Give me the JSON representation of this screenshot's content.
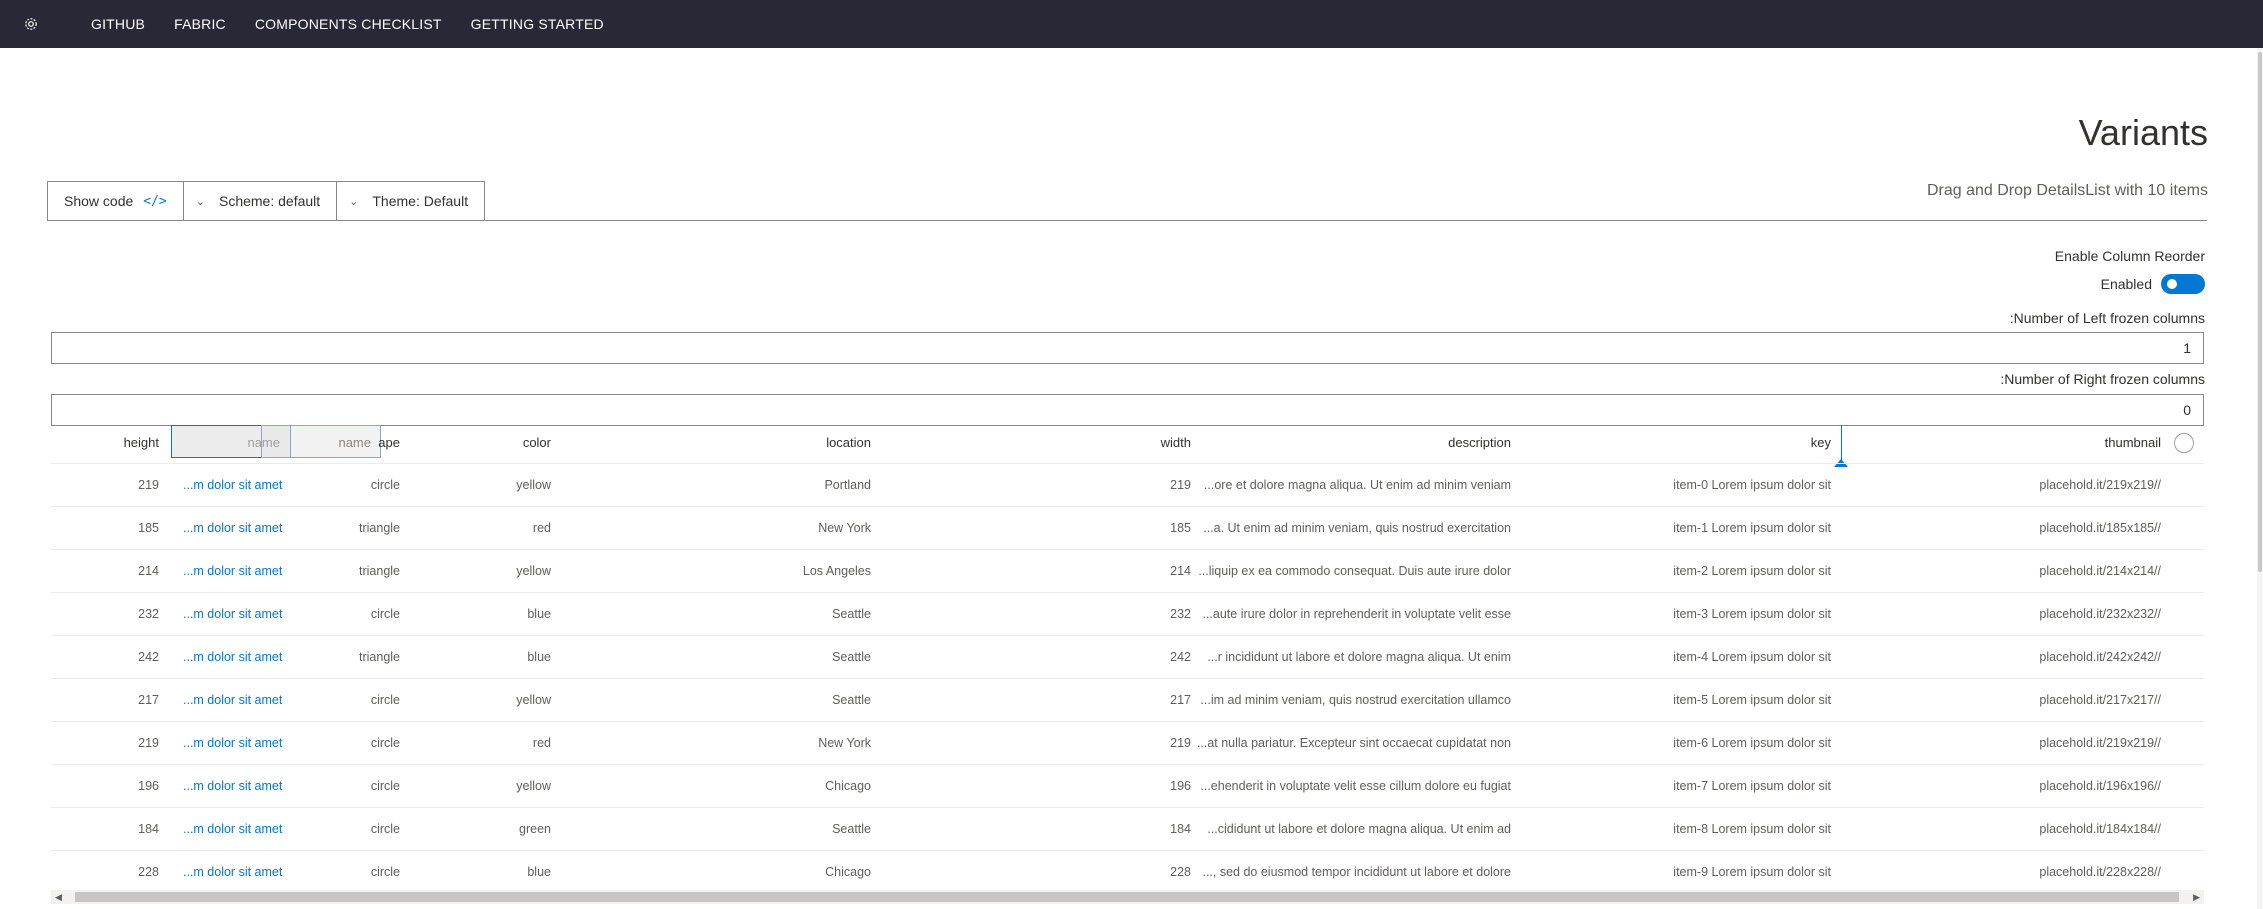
{
  "nav": {
    "links": [
      "GITHUB",
      "FABRIC",
      "COMPONENTS CHECKLIST",
      "GETTING STARTED"
    ]
  },
  "page": {
    "title": "Variants",
    "subtitle": "Drag and Drop DetailsList with 10 items"
  },
  "toolbar": {
    "show_code": "Show code",
    "code_icon": "</>",
    "scheme": "Scheme: default",
    "theme": "Theme: Default"
  },
  "controls": {
    "reorder_label": "Enable Column Reorder",
    "toggle_label": "Enabled",
    "toggle_on": true,
    "left_label": ":Number of Left frozen columns",
    "left_value": "1",
    "right_label": ":Number of Right frozen columns",
    "right_value": "0"
  },
  "columns": {
    "height": "height",
    "name_ghost": "name",
    "name_ghost2": "name",
    "shape": "ape",
    "color": "color",
    "location": "location",
    "width": "width",
    "description": "description",
    "key": "key",
    "thumbnail": "thumbnail"
  },
  "rows": [
    {
      "height": "219",
      "name": "...m dolor sit amet",
      "shape": "circle",
      "color": "yellow",
      "location": "Portland",
      "width": "219",
      "description": "...ore et dolore magna aliqua. Ut enim ad minim veniam",
      "key": "item-0 Lorem ipsum dolor sit",
      "thumbnail": "placehold.it/219x219//"
    },
    {
      "height": "185",
      "name": "...m dolor sit amet",
      "shape": "triangle",
      "color": "red",
      "location": "New York",
      "width": "185",
      "description": "...a. Ut enim ad minim veniam, quis nostrud exercitation",
      "key": "item-1 Lorem ipsum dolor sit",
      "thumbnail": "placehold.it/185x185//"
    },
    {
      "height": "214",
      "name": "...m dolor sit amet",
      "shape": "triangle",
      "color": "yellow",
      "location": "Los Angeles",
      "width": "214",
      "description": "...liquip ex ea commodo consequat. Duis aute irure dolor",
      "key": "item-2 Lorem ipsum dolor sit",
      "thumbnail": "placehold.it/214x214//"
    },
    {
      "height": "232",
      "name": "...m dolor sit amet",
      "shape": "circle",
      "color": "blue",
      "location": "Seattle",
      "width": "232",
      "description": "...aute irure dolor in reprehenderit in voluptate velit esse",
      "key": "item-3 Lorem ipsum dolor sit",
      "thumbnail": "placehold.it/232x232//"
    },
    {
      "height": "242",
      "name": "...m dolor sit amet",
      "shape": "triangle",
      "color": "blue",
      "location": "Seattle",
      "width": "242",
      "description": "...r incididunt ut labore et dolore magna aliqua. Ut enim",
      "key": "item-4 Lorem ipsum dolor sit",
      "thumbnail": "placehold.it/242x242//"
    },
    {
      "height": "217",
      "name": "...m dolor sit amet",
      "shape": "circle",
      "color": "yellow",
      "location": "Seattle",
      "width": "217",
      "description": "...im ad minim veniam, quis nostrud exercitation ullamco",
      "key": "item-5 Lorem ipsum dolor sit",
      "thumbnail": "placehold.it/217x217//"
    },
    {
      "height": "219",
      "name": "...m dolor sit amet",
      "shape": "circle",
      "color": "red",
      "location": "New York",
      "width": "219",
      "description": "...at nulla pariatur. Excepteur sint occaecat cupidatat non",
      "key": "item-6 Lorem ipsum dolor sit",
      "thumbnail": "placehold.it/219x219//"
    },
    {
      "height": "196",
      "name": "...m dolor sit amet",
      "shape": "circle",
      "color": "yellow",
      "location": "Chicago",
      "width": "196",
      "description": "...ehenderit in voluptate velit esse cillum dolore eu fugiat",
      "key": "item-7 Lorem ipsum dolor sit",
      "thumbnail": "placehold.it/196x196//"
    },
    {
      "height": "184",
      "name": "...m dolor sit amet",
      "shape": "circle",
      "color": "green",
      "location": "Seattle",
      "width": "184",
      "description": "...cididunt ut labore et dolore magna aliqua. Ut enim ad",
      "key": "item-8 Lorem ipsum dolor sit",
      "thumbnail": "placehold.it/184x184//"
    },
    {
      "height": "228",
      "name": "...m dolor sit amet",
      "shape": "circle",
      "color": "blue",
      "location": "Chicago",
      "width": "228",
      "description": "..., sed do eiusmod tempor incididunt ut labore et dolore",
      "key": "item-9 Lorem ipsum dolor sit",
      "thumbnail": "placehold.it/228x228//"
    }
  ],
  "colors": {
    "nav_bg": "#282936",
    "accent": "#0078d4"
  }
}
